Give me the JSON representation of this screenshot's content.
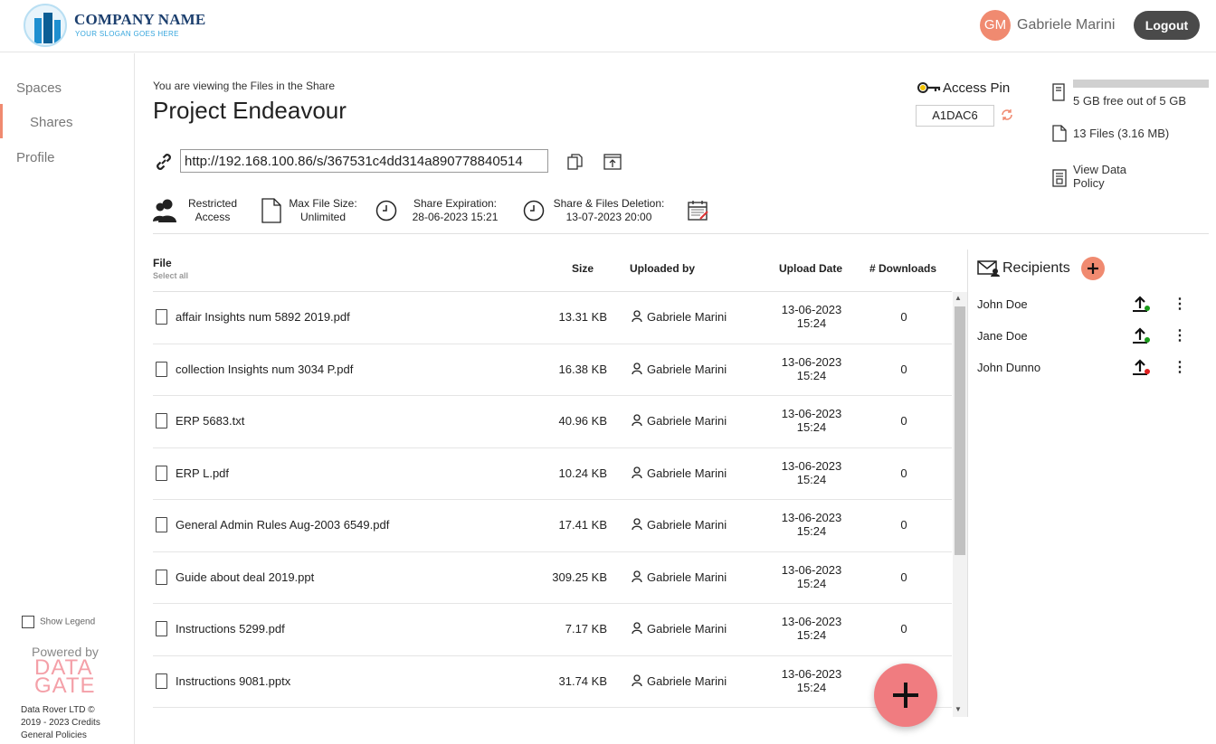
{
  "header": {
    "company_name": "COMPANY NAME",
    "slogan": "YOUR SLOGAN GOES HERE",
    "avatar_initials": "GM",
    "user_name": "Gabriele Marini",
    "logout_label": "Logout"
  },
  "sidebar": {
    "items": [
      {
        "label": "Spaces"
      },
      {
        "label": "Shares"
      },
      {
        "label": "Profile"
      }
    ],
    "show_legend": "Show Legend",
    "powered_by": "Powered by",
    "brand_line1": "DATA",
    "brand_line2": "GATE",
    "footer_line1": "Data Rover LTD ©",
    "footer_line2": "2019 - 2023 Credits",
    "footer_line3": "General Policies"
  },
  "share": {
    "viewing_text": "You are viewing the Files in the Share",
    "title": "Project Endeavour",
    "url": "http://192.168.100.86/s/367531c4dd314a890778840514",
    "access_label_1": "Restricted",
    "access_label_2": "Access",
    "max_size_label": "Max File Size:",
    "max_size_value": "Unlimited",
    "expiration_label": "Share Expiration:",
    "expiration_value": "28-06-2023 15:21",
    "deletion_label": "Share & Files Deletion:",
    "deletion_value": "13-07-2023 20:00",
    "access_pin_label": "Access Pin",
    "access_pin_value": "A1DAC6"
  },
  "storage": {
    "free_text": "5 GB free out of 5 GB",
    "files_text": "13 Files (3.16 MB)",
    "policy_line1": "View Data",
    "policy_line2": "Policy"
  },
  "table": {
    "col_file": "File",
    "select_all": "Select all",
    "col_size": "Size",
    "col_uploaded_by": "Uploaded by",
    "col_upload_date": "Upload Date",
    "col_downloads": "# Downloads",
    "rows": [
      {
        "name": "affair Insights num 5892 2019.pdf",
        "size": "13.31 KB",
        "uploader": "Gabriele Marini",
        "date": "13-06-2023",
        "time": "15:24",
        "downloads": "0"
      },
      {
        "name": "collection Insights num 3034 P.pdf",
        "size": "16.38 KB",
        "uploader": "Gabriele Marini",
        "date": "13-06-2023",
        "time": "15:24",
        "downloads": "0"
      },
      {
        "name": "ERP 5683.txt",
        "size": "40.96 KB",
        "uploader": "Gabriele Marini",
        "date": "13-06-2023",
        "time": "15:24",
        "downloads": "0"
      },
      {
        "name": "ERP L.pdf",
        "size": "10.24 KB",
        "uploader": "Gabriele Marini",
        "date": "13-06-2023",
        "time": "15:24",
        "downloads": "0"
      },
      {
        "name": "General Admin Rules Aug-2003 6549.pdf",
        "size": "17.41 KB",
        "uploader": "Gabriele Marini",
        "date": "13-06-2023",
        "time": "15:24",
        "downloads": "0"
      },
      {
        "name": "Guide about deal 2019.ppt",
        "size": "309.25 KB",
        "uploader": "Gabriele Marini",
        "date": "13-06-2023",
        "time": "15:24",
        "downloads": "0"
      },
      {
        "name": "Instructions 5299.pdf",
        "size": "7.17 KB",
        "uploader": "Gabriele Marini",
        "date": "13-06-2023",
        "time": "15:24",
        "downloads": "0"
      },
      {
        "name": "Instructions 9081.pptx",
        "size": "31.74 KB",
        "uploader": "Gabriele Marini",
        "date": "13-06-2023",
        "time": "15:24",
        "downloads": ""
      }
    ]
  },
  "recipients": {
    "title": "Recipients",
    "items": [
      {
        "name": "John Doe",
        "status_color": "#1a9a1a"
      },
      {
        "name": "Jane Doe",
        "status_color": "#1a9a1a"
      },
      {
        "name": "John Dunno",
        "status_color": "#e02020"
      }
    ]
  },
  "colors": {
    "accent": "#f08a70",
    "logout_bg": "#4a4a4a",
    "fab": "#f07c80"
  },
  "icons": [
    "building-logo-icon",
    "link-icon",
    "copy-icon",
    "share-window-icon",
    "users-icon",
    "file-icon",
    "clock-icon",
    "calendar-icon",
    "key-icon",
    "refresh-icon",
    "device-icon",
    "document-icon",
    "policy-icon",
    "mail-icon",
    "person-icon",
    "upload-status-icon",
    "more-vertical-icon",
    "plus-icon",
    "legend-icon"
  ]
}
